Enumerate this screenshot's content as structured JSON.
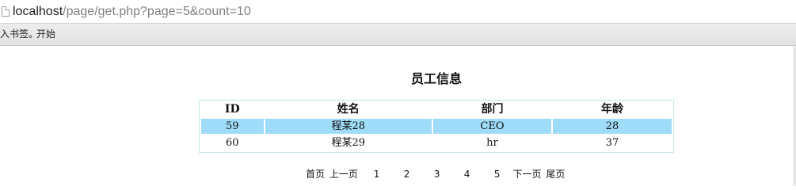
{
  "browser": {
    "url_host": "localhost",
    "url_path": "/page/get.php?page=5&count=10"
  },
  "bookmarks": {
    "items": [
      {
        "label": "入书签。"
      },
      {
        "label": "开始"
      }
    ]
  },
  "page": {
    "title": "员工信息"
  },
  "table": {
    "headers": [
      "ID",
      "姓名",
      "部门",
      "年龄"
    ],
    "rows": [
      {
        "id": "59",
        "name": "程某28",
        "dept": "CEO",
        "age": "28",
        "highlighted": true
      },
      {
        "id": "60",
        "name": "程某29",
        "dept": "hr",
        "age": "37",
        "highlighted": false
      }
    ]
  },
  "pager": {
    "first": "首页",
    "prev": "上一页",
    "pages": [
      "1",
      "2",
      "3",
      "4",
      "5"
    ],
    "next": "下一页",
    "last": "尾页"
  },
  "colors": {
    "highlight_row": "#9fdcf9",
    "table_border": "#bfe6ea"
  }
}
